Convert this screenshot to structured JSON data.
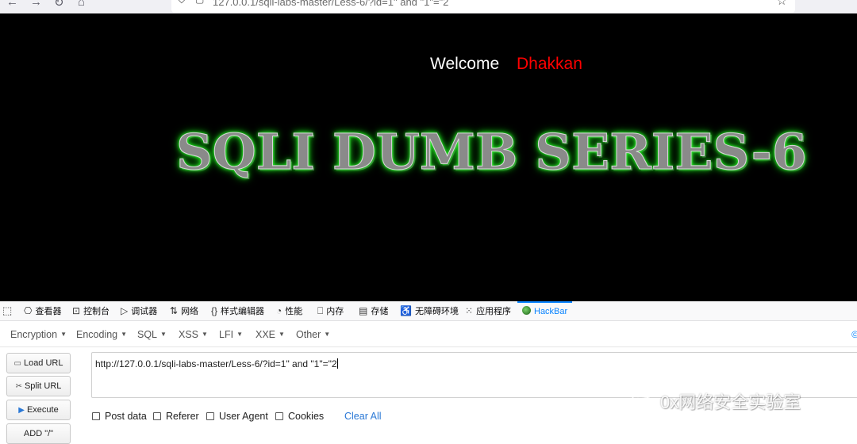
{
  "browser": {
    "back_icon": "←",
    "forward_icon": "→",
    "reload_icon": "↻",
    "home_icon": "⌂",
    "url": "127.0.0.1/sqli-labs-master/Less-6/?id=1\" and \"1\"=\"2",
    "star_icon": "☆"
  },
  "page": {
    "welcome_label": "Welcome",
    "welcome_name": "Dhakkan",
    "banner_text": "SQLI DUMB SERIES-6"
  },
  "devtools": {
    "tabs": [
      {
        "icon": "⎔",
        "label": "查看器"
      },
      {
        "icon": "⊡",
        "label": "控制台"
      },
      {
        "icon": "▷",
        "label": "调试器"
      },
      {
        "icon": "⇅",
        "label": "网络"
      },
      {
        "icon": "{}",
        "label": "样式编辑器"
      },
      {
        "icon": "◔",
        "label": "性能"
      },
      {
        "icon": "⎕",
        "label": "内存"
      },
      {
        "icon": "▤",
        "label": "存储"
      },
      {
        "icon": "♿",
        "label": "无障碍环境"
      },
      {
        "icon": "⁙",
        "label": "应用程序"
      },
      {
        "icon": "",
        "label": "HackBar"
      }
    ]
  },
  "hackbar": {
    "menu": [
      "Encryption",
      "Encoding",
      "SQL",
      "XSS",
      "LFI",
      "XXE",
      "Other"
    ],
    "corner_text": "©",
    "buttons": {
      "load_url": "Load URL",
      "split_url": "Split URL",
      "execute": "Execute",
      "add_slash": "ADD \"/\""
    },
    "url_value": "http://127.0.0.1/sqli-labs-master/Less-6/?id=1\" and \"1\"=\"2",
    "options": {
      "post_data": "Post data",
      "referer": "Referer",
      "user_agent": "User Agent",
      "cookies": "Cookies"
    },
    "clear_all": "Clear All"
  },
  "watermark": {
    "text": "0x网络安全实验室"
  },
  "colors": {
    "page_bg": "#000000",
    "welcome": "#ffffff",
    "name": "#ff0000",
    "banner_glow": "#2bff2b",
    "active_tab": "#0a84ff",
    "link": "#2a78d6"
  }
}
